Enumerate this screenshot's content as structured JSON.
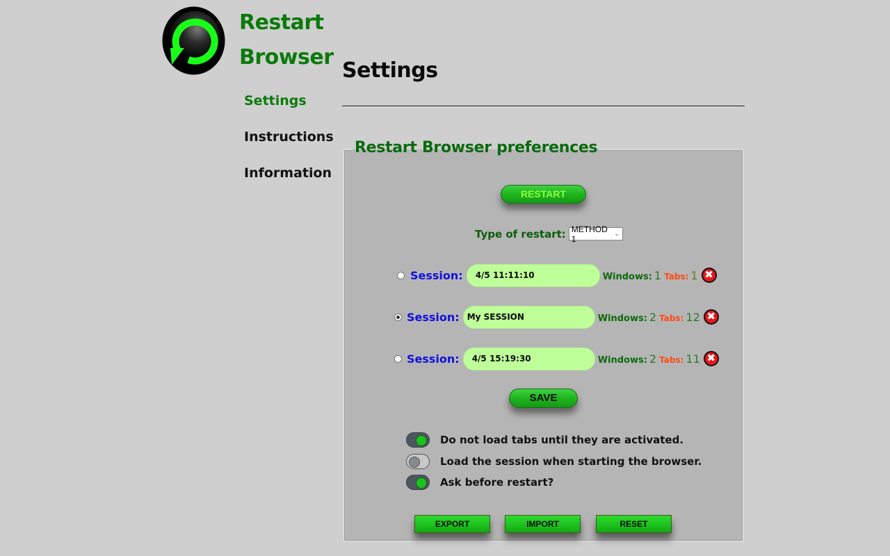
{
  "app": {
    "name_line1": "Restart",
    "name_line2": "Browser",
    "logo_icon": "restart-circular-arrow-icon"
  },
  "sidebar": {
    "items": [
      {
        "label": "Settings",
        "active": true
      },
      {
        "label": "Instructions",
        "active": false
      },
      {
        "label": "Information",
        "active": false
      }
    ]
  },
  "page": {
    "title": "Settings"
  },
  "preferences": {
    "legend": "Restart Browser preferences",
    "restart_button": "RESTART",
    "restart_type_label": "Type of restart:",
    "restart_type_value": "METHOD 1",
    "sessions": [
      {
        "label": "Session:",
        "name": "4/5 11:11:10",
        "selected": false,
        "windows_label": "Windows:",
        "windows": "1",
        "tabs_label": "Tabs:",
        "tabs": "1"
      },
      {
        "label": "Session:",
        "name": "My SESSION",
        "selected": true,
        "windows_label": "Windows:",
        "windows": "2",
        "tabs_label": "Tabs:",
        "tabs": "12"
      },
      {
        "label": "Session:",
        "name": "4/5 15:19:30",
        "selected": false,
        "windows_label": "Windows:",
        "windows": "2",
        "tabs_label": "Tabs:",
        "tabs": "11"
      }
    ],
    "delete_icon": "close-x-icon",
    "save_button": "SAVE",
    "toggles": [
      {
        "label": "Do not load tabs until they are activated.",
        "on": true
      },
      {
        "label": "Load the session when starting the browser.",
        "on": false
      },
      {
        "label": "Ask before restart?",
        "on": true
      }
    ],
    "export_button": "EXPORT",
    "import_button": "IMPORT",
    "reset_button": "RESET"
  },
  "colors": {
    "brand_green": "#0b7a0b",
    "session_blue": "#1010e0",
    "tabs_orange": "#ff4a12",
    "input_green": "#bfff9a",
    "button_green": "#1fb41f"
  }
}
